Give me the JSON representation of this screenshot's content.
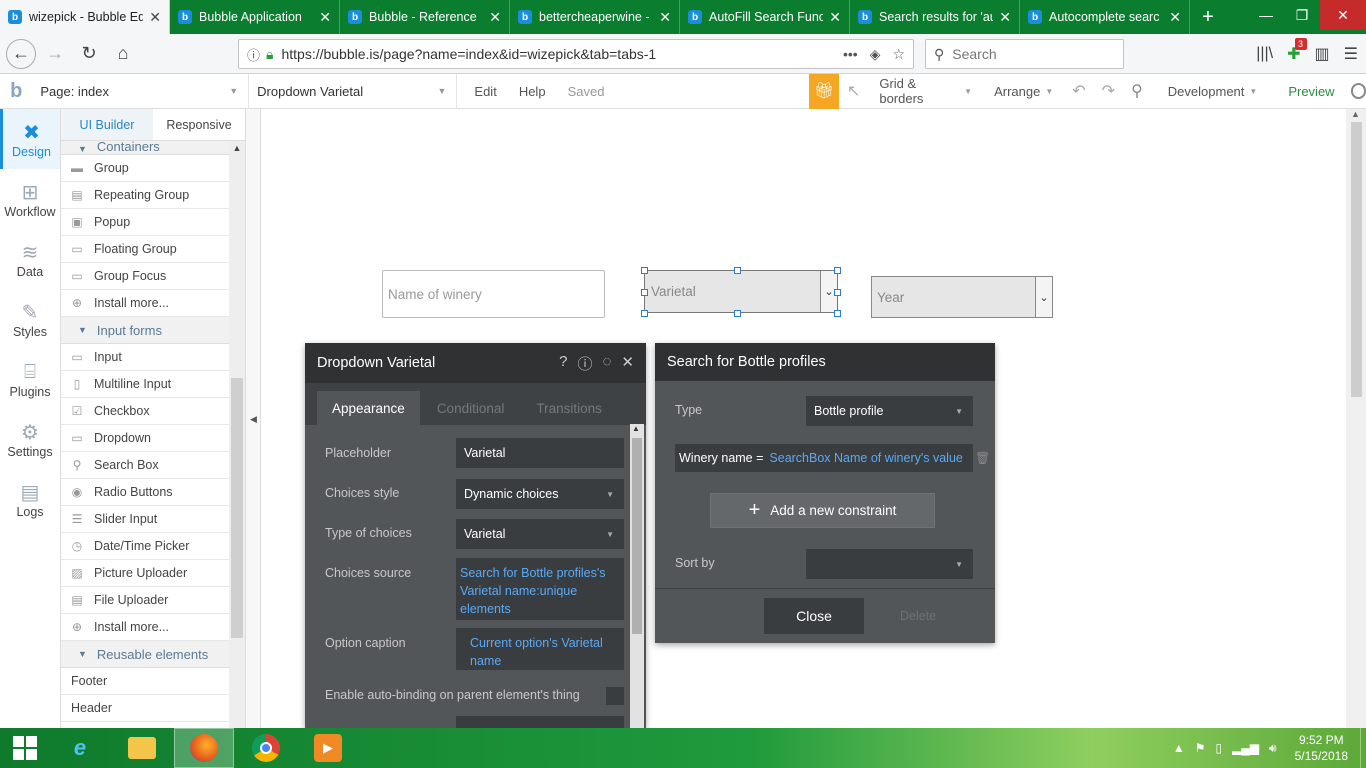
{
  "browser": {
    "tabs": [
      {
        "title": "wizepick - Bubble Ed",
        "active": true
      },
      {
        "title": "Bubble Application",
        "active": false
      },
      {
        "title": "Bubble - Reference",
        "active": false
      },
      {
        "title": "bettercheaperwine -",
        "active": false
      },
      {
        "title": "AutoFill Search Func",
        "active": false
      },
      {
        "title": "Search results for 'au",
        "active": false
      },
      {
        "title": "Autocomplete searc",
        "active": false
      }
    ],
    "url": "https://bubble.is/page?name=index&id=wizepick&tab=tabs-1",
    "search_placeholder": "Search",
    "notification_count": "3"
  },
  "bubble_top": {
    "page_selector": "Page: index",
    "element_selector": "Dropdown Varietal",
    "menu_edit": "Edit",
    "menu_help": "Help",
    "status": "Saved",
    "grid_borders": "Grid & borders",
    "arrange": "Arrange",
    "environment": "Development",
    "preview": "Preview"
  },
  "left_nav": [
    {
      "label": "Design",
      "icon": "design-icon",
      "active": true
    },
    {
      "label": "Workflow",
      "icon": "workflow-icon",
      "active": false
    },
    {
      "label": "Data",
      "icon": "database-icon",
      "active": false
    },
    {
      "label": "Styles",
      "icon": "brush-icon",
      "active": false
    },
    {
      "label": "Plugins",
      "icon": "plug-icon",
      "active": false
    },
    {
      "label": "Settings",
      "icon": "gear-icon",
      "active": false
    },
    {
      "label": "Logs",
      "icon": "document-icon",
      "active": false
    }
  ],
  "palette": {
    "tabs": [
      "UI Builder",
      "Responsive"
    ],
    "sections": {
      "containers": "Containers",
      "input_forms": "Input forms",
      "reusable": "Reusable elements"
    },
    "containers_items": [
      "Group",
      "Repeating Group",
      "Popup",
      "Floating Group",
      "Group Focus",
      "Install more..."
    ],
    "input_items": [
      "Input",
      "Multiline Input",
      "Checkbox",
      "Dropdown",
      "Search Box",
      "Radio Buttons",
      "Slider Input",
      "Date/Time Picker",
      "Picture Uploader",
      "File Uploader",
      "Install more..."
    ],
    "reusable_items": [
      "Footer",
      "Header"
    ]
  },
  "canvas": {
    "winery_placeholder": "Name of winery",
    "varietal_placeholder": "Varietal",
    "year_placeholder": "Year"
  },
  "property_editor": {
    "title": "Dropdown Varietal",
    "tabs": [
      "Appearance",
      "Conditional",
      "Transitions"
    ],
    "placeholder_label": "Placeholder",
    "placeholder_value": "Varietal",
    "choices_style_label": "Choices style",
    "choices_style_value": "Dynamic choices",
    "type_label": "Type of choices",
    "type_value": "Varietal",
    "source_label": "Choices source",
    "source_value": "Search for Bottle profiles's Varietal name:unique elements",
    "caption_label": "Option caption",
    "caption_value": "Current option's Varietal name",
    "autobinding_label": "Enable auto-binding on parent element's thing"
  },
  "search_editor": {
    "title": "Search for Bottle profiles",
    "type_label": "Type",
    "type_value": "Bottle profile",
    "constraint_key": "Winery name =",
    "constraint_value": "SearchBox Name of winery's value",
    "add_constraint": "Add a new constraint",
    "sort_label": "Sort by",
    "close": "Close",
    "delete": "Delete"
  },
  "taskbar": {
    "time": "9:52 PM",
    "date": "5/15/2018"
  },
  "colors": {
    "firefox_green": "#0b7d2f",
    "bubble_blue": "#1a8ddb",
    "editor_dark": "#535659",
    "editor_header": "#2f3133",
    "link_blue": "#5aa9f5",
    "gift_orange": "#f5a623"
  }
}
